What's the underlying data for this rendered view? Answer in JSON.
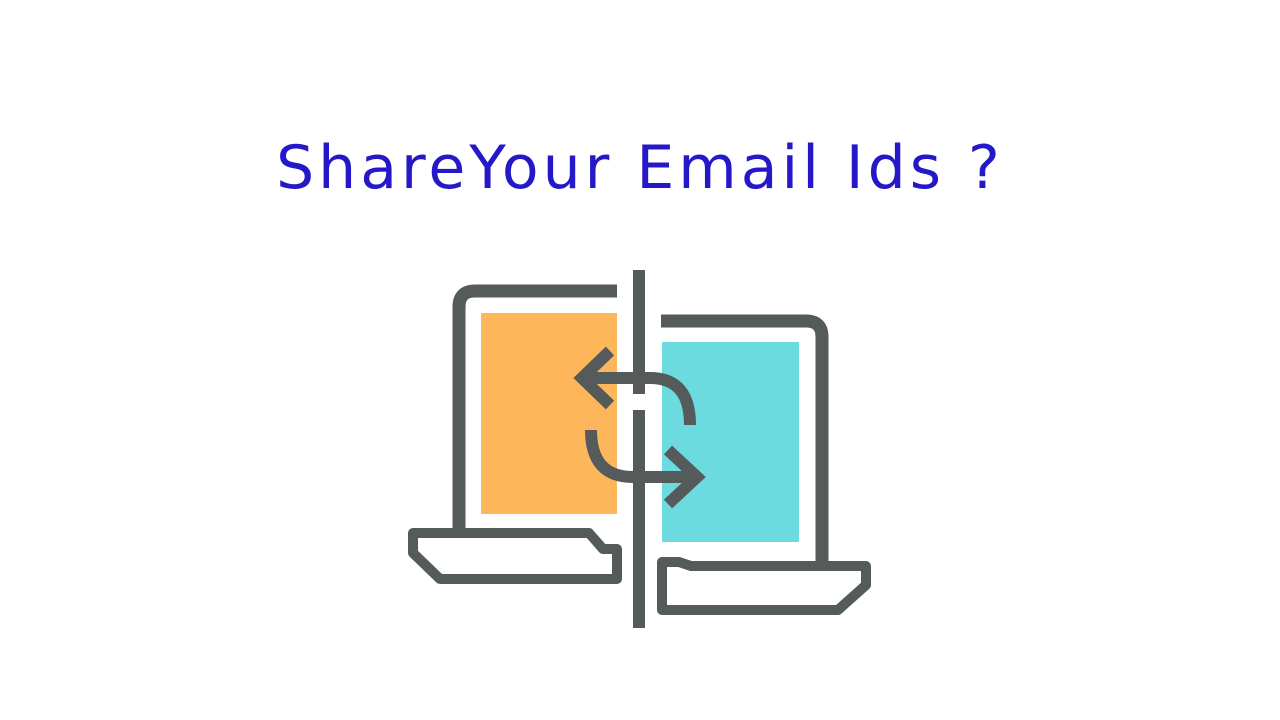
{
  "headline": {
    "text": "ShareYour Email Ids ?",
    "color": "#2418c8"
  },
  "illustration": {
    "icon": "laptops-sync-icon",
    "colors": {
      "outline": "#555a5a",
      "left_screen": "#fdb75a",
      "right_screen": "#6cdbe0"
    }
  }
}
